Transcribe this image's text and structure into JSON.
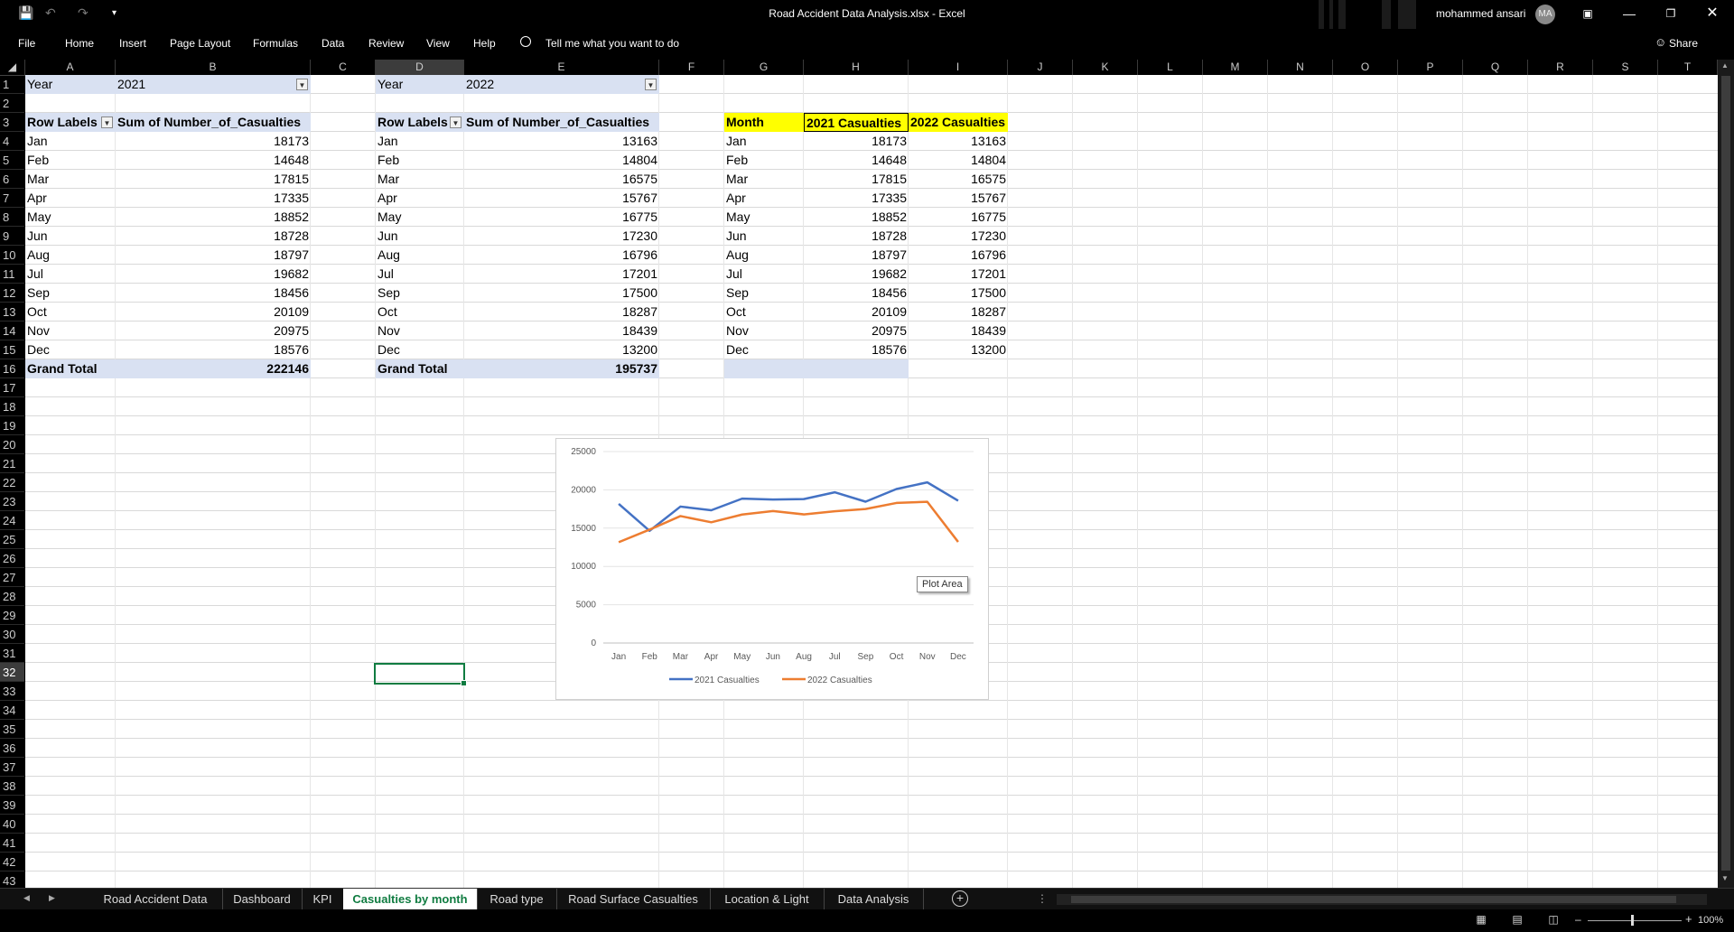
{
  "app": {
    "title": "Road Accident Data Analysis.xlsx  -  Excel",
    "user_name": "mohammed ansari",
    "user_initials": "MA"
  },
  "ribbon": {
    "tabs": [
      "File",
      "Home",
      "Insert",
      "Page Layout",
      "Formulas",
      "Data",
      "Review",
      "View",
      "Help"
    ],
    "tell_me": "Tell me what you want to do",
    "share": "Share"
  },
  "columns": [
    "A",
    "B",
    "C",
    "D",
    "E",
    "F",
    "G",
    "H",
    "I",
    "J",
    "K",
    "L",
    "M",
    "N",
    "O",
    "P",
    "Q",
    "R",
    "S",
    "T"
  ],
  "rows": [
    "1",
    "2",
    "3",
    "4",
    "5",
    "6",
    "7",
    "8",
    "9",
    "10",
    "11",
    "12",
    "13",
    "14",
    "15",
    "16",
    "17",
    "18",
    "19",
    "20",
    "21",
    "22",
    "23",
    "24",
    "25",
    "26",
    "27",
    "28",
    "29",
    "30",
    "31",
    "32",
    "33",
    "34",
    "35",
    "36",
    "37",
    "38",
    "39",
    "40",
    "41",
    "42",
    "43"
  ],
  "pivot1": {
    "filter_label": "Year",
    "filter_value": "2021",
    "row_labels": "Row Labels",
    "sum_header": "Sum of Number_of_Casualties",
    "months": [
      "Jan",
      "Feb",
      "Mar",
      "Apr",
      "May",
      "Jun",
      "Aug",
      "Jul",
      "Sep",
      "Oct",
      "Nov",
      "Dec"
    ],
    "values": [
      "18173",
      "14648",
      "17815",
      "17335",
      "18852",
      "18728",
      "18797",
      "19682",
      "18456",
      "20109",
      "20975",
      "18576"
    ],
    "grand_total_label": "Grand Total",
    "grand_total": "222146"
  },
  "pivot2": {
    "filter_label": "Year",
    "filter_value": "2022",
    "row_labels": "Row Labels",
    "sum_header": "Sum of Number_of_Casualties",
    "months": [
      "Jan",
      "Feb",
      "Mar",
      "Apr",
      "May",
      "Jun",
      "Aug",
      "Jul",
      "Sep",
      "Oct",
      "Nov",
      "Dec"
    ],
    "values": [
      "13163",
      "14804",
      "16575",
      "15767",
      "16775",
      "17230",
      "16796",
      "17201",
      "17500",
      "18287",
      "18439",
      "13200"
    ],
    "grand_total_label": "Grand Total",
    "grand_total": "195737"
  },
  "summary_table": {
    "headers": [
      "Month",
      "2021 Casualties",
      "2022 Casualties"
    ],
    "months": [
      "Jan",
      "Feb",
      "Mar",
      "Apr",
      "May",
      "Jun",
      "Aug",
      "Jul",
      "Sep",
      "Oct",
      "Nov",
      "Dec"
    ],
    "col2021": [
      "18173",
      "14648",
      "17815",
      "17335",
      "18852",
      "18728",
      "18797",
      "19682",
      "18456",
      "20109",
      "20975",
      "18576"
    ],
    "col2022": [
      "13163",
      "14804",
      "16575",
      "15767",
      "16775",
      "17230",
      "16796",
      "17201",
      "17500",
      "18287",
      "18439",
      "13200"
    ]
  },
  "chart_data": {
    "type": "line",
    "categories": [
      "Jan",
      "Feb",
      "Mar",
      "Apr",
      "May",
      "Jun",
      "Aug",
      "Jul",
      "Sep",
      "Oct",
      "Nov",
      "Dec"
    ],
    "series": [
      {
        "name": "2021 Casualties",
        "color": "#4472c4",
        "values": [
          18173,
          14648,
          17815,
          17335,
          18852,
          18728,
          18797,
          19682,
          18456,
          20109,
          20975,
          18576
        ]
      },
      {
        "name": "2022 Casualties",
        "color": "#ed7d31",
        "values": [
          13163,
          14804,
          16575,
          15767,
          16775,
          17230,
          16796,
          17201,
          17500,
          18287,
          18439,
          13200
        ]
      }
    ],
    "ylim": [
      0,
      25000
    ],
    "yticks": [
      "25000",
      "20000",
      "15000",
      "10000",
      "5000",
      "0"
    ],
    "xticks": [
      "Jan",
      "Feb",
      "Mar",
      "Apr",
      "May",
      "Jun",
      "Aug",
      "Jul",
      "Sep",
      "Oct",
      "Nov",
      "Dec"
    ],
    "legend": "bottom",
    "grid": true
  },
  "tooltip": "Plot Area",
  "sheet_tabs": [
    "Road Accident Data",
    "Dashboard",
    "KPI",
    "Casualties by month",
    "Road type",
    "Road Surface Casualties",
    "Location & Light",
    "Data Analysis"
  ],
  "active_tab": "Casualties by month",
  "zoom": "100%"
}
